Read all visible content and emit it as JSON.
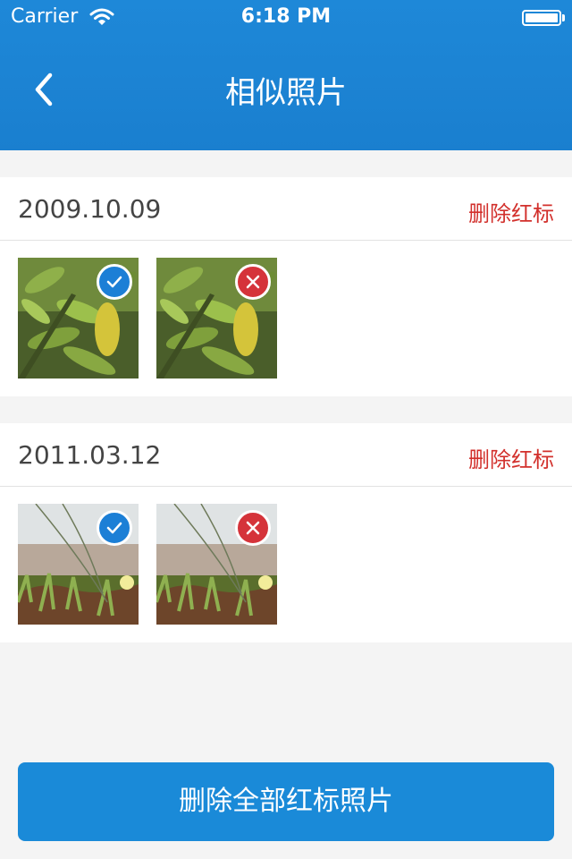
{
  "status_bar": {
    "carrier": "Carrier",
    "time": "6:18 PM"
  },
  "nav": {
    "title": "相似照片",
    "back_icon": "chevron-left-icon"
  },
  "groups": [
    {
      "date": "2009.10.09",
      "action_label": "删除红标",
      "photos": [
        {
          "subject": "leaves",
          "status": "keep",
          "badge_icon": "check-icon"
        },
        {
          "subject": "leaves",
          "status": "delete",
          "badge_icon": "close-icon"
        }
      ]
    },
    {
      "date": "2011.03.12",
      "action_label": "删除红标",
      "photos": [
        {
          "subject": "grass-beach",
          "status": "keep",
          "badge_icon": "check-icon"
        },
        {
          "subject": "grass-beach",
          "status": "delete",
          "badge_icon": "close-icon"
        }
      ]
    }
  ],
  "footer": {
    "button_label": "删除全部红标照片"
  },
  "colors": {
    "primary": "#1a8ad8",
    "danger": "#d2302c",
    "keep_badge": "#1c7fd6",
    "delete_badge": "#d5333a"
  }
}
